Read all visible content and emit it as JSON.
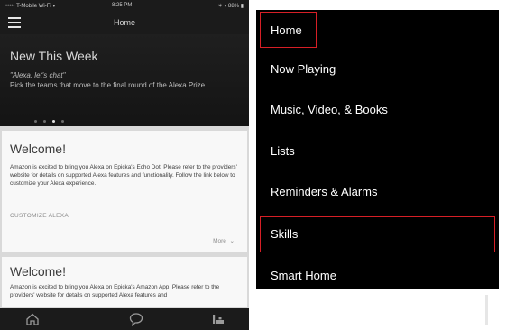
{
  "phone": {
    "status": {
      "carrier": "••••◦ T-Mobile Wi-Fi ▾",
      "time": "8:25 PM",
      "battery": "✶ ▾ 88% ▮"
    },
    "header_title": "Home",
    "hero": {
      "title": "New This Week",
      "subtitle_quote": "\"Alexa, let's chat\"",
      "subtitle_text": "Pick the teams that move to the final round of the Alexa Prize."
    },
    "cards": [
      {
        "title": "Welcome!",
        "body": "Amazon is excited to bring you Alexa on Epicka's Echo Dot. Please refer to the providers' website for details on supported Alexa features and functionality. Follow the link below to customize your Alexa experience.",
        "link": "CUSTOMIZE ALEXA",
        "more": "More"
      },
      {
        "title": "Welcome!",
        "body": "Amazon is excited to bring you Alexa on Epicka's Amazon App. Please refer to the providers' website for details on supported Alexa features and"
      }
    ],
    "icons": {
      "menu": "hamburger-icon",
      "home": "home-icon",
      "chat": "chat-bubble-icon",
      "communicate": "people-icon"
    }
  },
  "menu": {
    "items": [
      {
        "label": "Home"
      },
      {
        "label": "Now Playing"
      },
      {
        "label": "Music, Video, & Books"
      },
      {
        "label": "Lists"
      },
      {
        "label": "Reminders & Alarms"
      },
      {
        "label": "Skills"
      },
      {
        "label": "Smart Home"
      }
    ],
    "highlight_color": "#d61f26",
    "background": "#000000"
  }
}
